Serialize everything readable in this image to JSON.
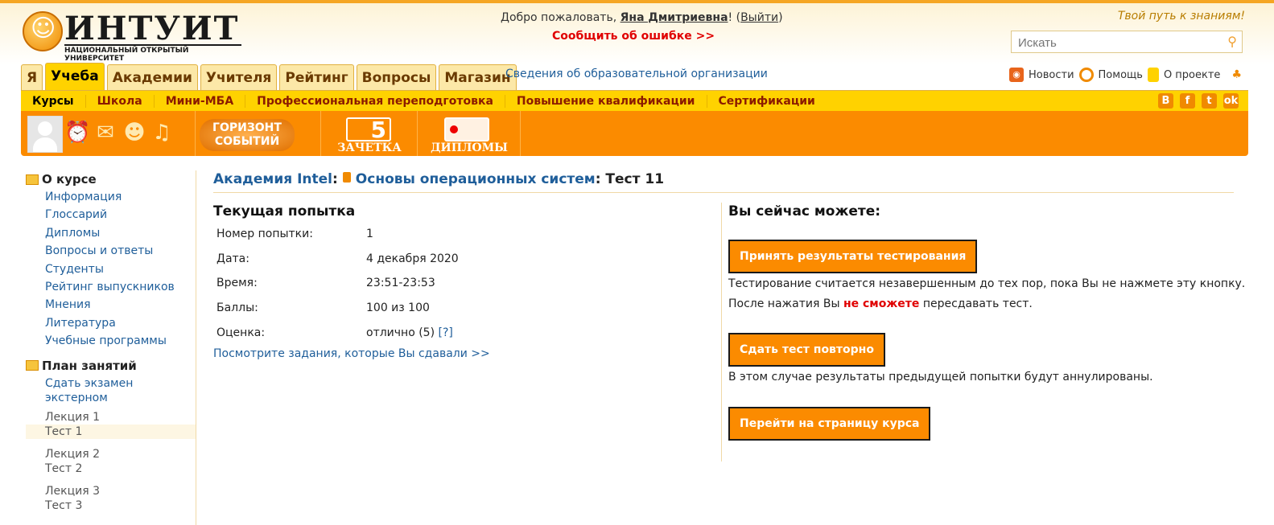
{
  "brand": {
    "logo_text": "ИНТУИТ",
    "logo_sub": "НАЦИОНАЛЬНЫЙ ОТКРЫТЫЙ УНИВЕРСИТЕТ",
    "slogan": "Твой путь к знаниям!"
  },
  "header": {
    "welcome_prefix": "Добро пожаловать,",
    "user_name": "Яна Дмитриевна",
    "bang": "!",
    "open_paren": "(",
    "logout": "Выйти",
    "close_paren": ")",
    "report_error": "Сообщить об ошибке >>",
    "search_placeholder": "Искать"
  },
  "tabs": [
    {
      "label": "Я",
      "active": false
    },
    {
      "label": "Учеба",
      "active": true
    },
    {
      "label": "Академии",
      "active": false
    },
    {
      "label": "Учителя",
      "active": false
    },
    {
      "label": "Рейтинг",
      "active": false
    },
    {
      "label": "Вопросы",
      "active": false
    },
    {
      "label": "Магазин",
      "active": false
    }
  ],
  "org_info_link": "Сведения об образовательной организации",
  "right_links": {
    "news": "Новости",
    "help": "Помощь",
    "about": "О проекте"
  },
  "subnav": [
    "Курсы",
    "Школа",
    "Мини-МБА",
    "Профессиональная переподготовка",
    "Повышение квалификации",
    "Сертификации"
  ],
  "social": [
    "B",
    "f",
    "t",
    "ok"
  ],
  "band": {
    "horizon_line1": "ГОРИЗОНТ",
    "horizon_line2": "СОБЫТИЙ",
    "grade_number": "5",
    "grade_label": "ЗАЧЕТКА",
    "diplomas_label": "ДИПЛОМЫ"
  },
  "sidebar": {
    "about_title": "О курсе",
    "about_links": [
      "Информация",
      "Глоссарий",
      "Дипломы",
      "Вопросы и ответы",
      "Студенты",
      "Рейтинг выпускников",
      "Мнения",
      "Литература",
      "Учебные программы"
    ],
    "plan_title": "План занятий",
    "exam_line1": "Сдать экзамен",
    "exam_line2": "экстерном",
    "lessons": [
      {
        "lecture": "Лекция 1",
        "test": "Тест 1",
        "current": true
      },
      {
        "lecture": "Лекция 2",
        "test": "Тест 2",
        "current": false
      },
      {
        "lecture": "Лекция 3",
        "test": "Тест 3",
        "current": false
      }
    ]
  },
  "breadcrumb": {
    "academy": "Академия Intel",
    "colon1": ":",
    "course": "Основы операционных систем",
    "colon2": ":",
    "test": "Тест 11"
  },
  "attempt": {
    "title": "Текущая попытка",
    "rows": [
      {
        "label": "Номер попытки:",
        "value": "1"
      },
      {
        "label": "Дата:",
        "value": "4 декабря 2020"
      },
      {
        "label": "Время:",
        "value": "23:51-23:53"
      },
      {
        "label": "Баллы:",
        "value": "100 из 100"
      },
      {
        "label": "Оценка:",
        "value": "отлично (5)",
        "hint": "[?]"
      }
    ],
    "tasks_link": "Посмотрите задания, которые Вы сдавали >>"
  },
  "actions": {
    "title": "Вы сейчас можете:",
    "accept_button": "Принять результаты тестирования",
    "accept_note1": "Тестирование считается незавершенным до тех пор, пока Вы не нажмете эту кнопку.",
    "accept_note2_pre": "После нажатия Вы",
    "accept_note2_warn": "не сможете",
    "accept_note2_post": "пересдавать тест.",
    "retake_button": "Сдать тест повторно",
    "retake_note": "В этом случае результаты предыдущей попытки будут аннулированы.",
    "course_button": "Перейти на страницу курса"
  },
  "colors": {
    "orange": "#fb8b00",
    "yellow": "#ffd200",
    "link": "#1f5e9a",
    "warn": "#e00000"
  }
}
